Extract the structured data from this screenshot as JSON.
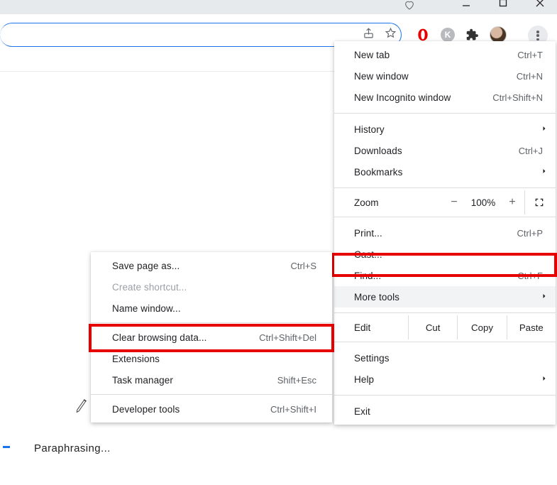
{
  "window": {
    "heart_tooltip": "heart",
    "minimize": "Minimize",
    "maximize": "Maximize",
    "close": "Close"
  },
  "toolbar": {
    "share": "Share",
    "star": "Bookmark this tab"
  },
  "extensions": {
    "ext1": "O",
    "ext2": "K",
    "puzzle": "Extensions"
  },
  "menu": {
    "new_tab": "New tab",
    "new_tab_sc": "Ctrl+T",
    "new_window": "New window",
    "new_window_sc": "Ctrl+N",
    "incognito": "New Incognito window",
    "incognito_sc": "Ctrl+Shift+N",
    "history": "History",
    "downloads": "Downloads",
    "downloads_sc": "Ctrl+J",
    "bookmarks": "Bookmarks",
    "zoom": "Zoom",
    "zoom_minus": "−",
    "zoom_pct": "100%",
    "zoom_plus": "+",
    "print": "Print...",
    "print_sc": "Ctrl+P",
    "cast": "Cast...",
    "find": "Find...",
    "find_sc": "Ctrl+F",
    "more_tools": "More tools",
    "edit": "Edit",
    "cut": "Cut",
    "copy": "Copy",
    "paste": "Paste",
    "settings": "Settings",
    "help": "Help",
    "exit": "Exit"
  },
  "submenu": {
    "save_page": "Save page as...",
    "save_page_sc": "Ctrl+S",
    "create_shortcut": "Create shortcut...",
    "name_window": "Name window...",
    "clear_browsing": "Clear browsing data...",
    "clear_browsing_sc": "Ctrl+Shift+Del",
    "extensions": "Extensions",
    "task_manager": "Task manager",
    "task_manager_sc": "Shift+Esc",
    "developer_tools": "Developer tools",
    "developer_tools_sc": "Ctrl+Shift+I"
  },
  "page": {
    "paraphrase": "Paraphrasing..."
  }
}
